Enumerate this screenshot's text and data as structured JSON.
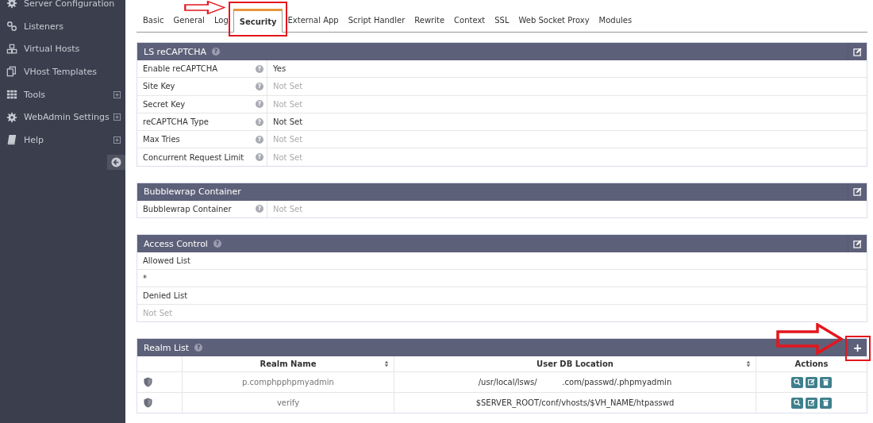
{
  "sidebar": {
    "items": [
      {
        "label": "Server Configuration",
        "expandable": false
      },
      {
        "label": "Listeners",
        "expandable": false
      },
      {
        "label": "Virtual Hosts",
        "expandable": false
      },
      {
        "label": "VHost Templates",
        "expandable": false
      },
      {
        "label": "Tools",
        "expandable": true
      },
      {
        "label": "WebAdmin Settings",
        "expandable": true
      },
      {
        "label": "Help",
        "expandable": true
      }
    ]
  },
  "tabs": [
    {
      "label": "Basic",
      "selected": false
    },
    {
      "label": "General",
      "selected": false
    },
    {
      "label": "Log",
      "selected": false
    },
    {
      "label": "Security",
      "selected": true
    },
    {
      "label": "External App",
      "selected": false
    },
    {
      "label": "Script Handler",
      "selected": false
    },
    {
      "label": "Rewrite",
      "selected": false
    },
    {
      "label": "Context",
      "selected": false
    },
    {
      "label": "SSL",
      "selected": false
    },
    {
      "label": "Web Socket Proxy",
      "selected": false
    },
    {
      "label": "Modules",
      "selected": false
    }
  ],
  "sections": [
    {
      "title": "LS reCAPTCHA",
      "help": "?",
      "header_button": {
        "kind": "edit"
      },
      "kind": "kv",
      "rows": [
        {
          "label": "Enable reCAPTCHA",
          "help": "?",
          "value": "Yes",
          "dimmed": false
        },
        {
          "label": "Site Key",
          "help": "?",
          "value": "Not Set",
          "dimmed": true
        },
        {
          "label": "Secret Key",
          "help": "?",
          "value": "Not Set",
          "dimmed": true
        },
        {
          "label": "reCAPTCHA Type",
          "help": "?",
          "value": "Not Set",
          "dimmed": false
        },
        {
          "label": "Max Tries",
          "help": "?",
          "value": "Not Set",
          "dimmed": true
        },
        {
          "label": "Concurrent Request Limit",
          "help": "?",
          "value": "Not Set",
          "dimmed": true
        }
      ]
    },
    {
      "title": "Bubblewrap Container",
      "header_button": {
        "kind": "edit"
      },
      "kind": "kv",
      "rows": [
        {
          "label": "Bubblewrap Container",
          "help": "?",
          "value": "Not Set",
          "dimmed": true
        }
      ]
    },
    {
      "title": "Access Control",
      "help": "?",
      "header_button": {
        "kind": "edit"
      },
      "kind": "list",
      "rows": [
        {
          "text": "Allowed List",
          "dimmed": false
        },
        {
          "text": "*",
          "dimmed": false
        },
        {
          "text": "Denied List",
          "dimmed": false
        },
        {
          "text": "Not Set",
          "dimmed": true
        }
      ]
    },
    {
      "title": "Realm List",
      "help": "?",
      "header_button": {
        "kind": "add",
        "label": "+"
      },
      "kind": "table",
      "columns": [
        {
          "label": "Realm Name",
          "sortable": true
        },
        {
          "label": "User DB Location",
          "sortable": true
        },
        {
          "label": "Actions",
          "sortable": false
        }
      ],
      "rows": [
        {
          "name": "p.comphpphpmyadmin",
          "location": "/usr/local/lsws/          .com/passwd/.phpmyadmin"
        },
        {
          "name": "verify",
          "location": "$SERVER_ROOT/conf/vhosts/$VH_NAME/htpasswd"
        }
      ]
    }
  ]
}
